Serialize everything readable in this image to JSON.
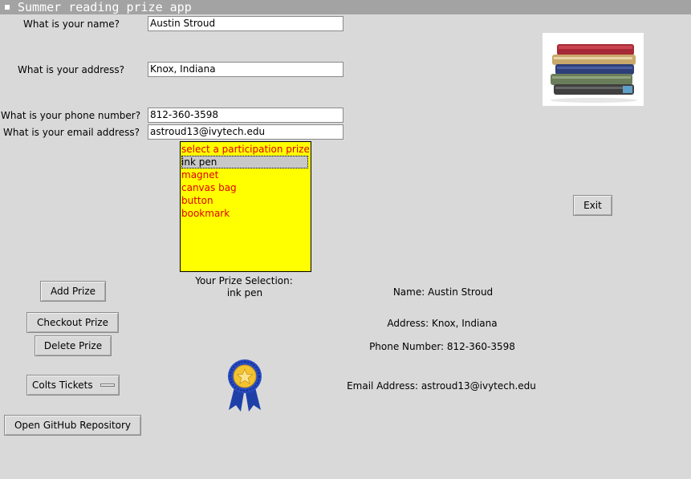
{
  "window": {
    "title": "Summer reading prize app"
  },
  "form": {
    "name_label": "What is your name?",
    "name_value": "Austin Stroud",
    "address_label": "What is your address?",
    "address_value": "Knox, Indiana",
    "phone_label": "What is your phone number?",
    "phone_value": "812-360-3598",
    "email_label": "What is your email address?",
    "email_value": "astroud13@ivytech.edu"
  },
  "prize_list": {
    "items": [
      "select a participation prize",
      "ink pen",
      "magnet",
      "canvas bag",
      "button",
      "bookmark"
    ],
    "selected": "ink pen",
    "background": "#ffff00",
    "text_color": "#e00000"
  },
  "selection": {
    "label": "Your Prize Selection:",
    "value": "ink pen"
  },
  "buttons": {
    "add": "Add Prize",
    "checkout": "Checkout Prize",
    "delete": "Delete Prize",
    "github": "Open GitHub Repository",
    "exit": "Exit"
  },
  "dropdown": {
    "selected": "Colts Tickets"
  },
  "summary": {
    "name": "Name: Austin Stroud",
    "address": "Address: Knox, Indiana",
    "phone": "Phone Number: 812-360-3598",
    "email": "Email Address: astroud13@ivytech.edu"
  },
  "images": {
    "books": "books-stack-image",
    "ribbon": "award-ribbon-image"
  }
}
